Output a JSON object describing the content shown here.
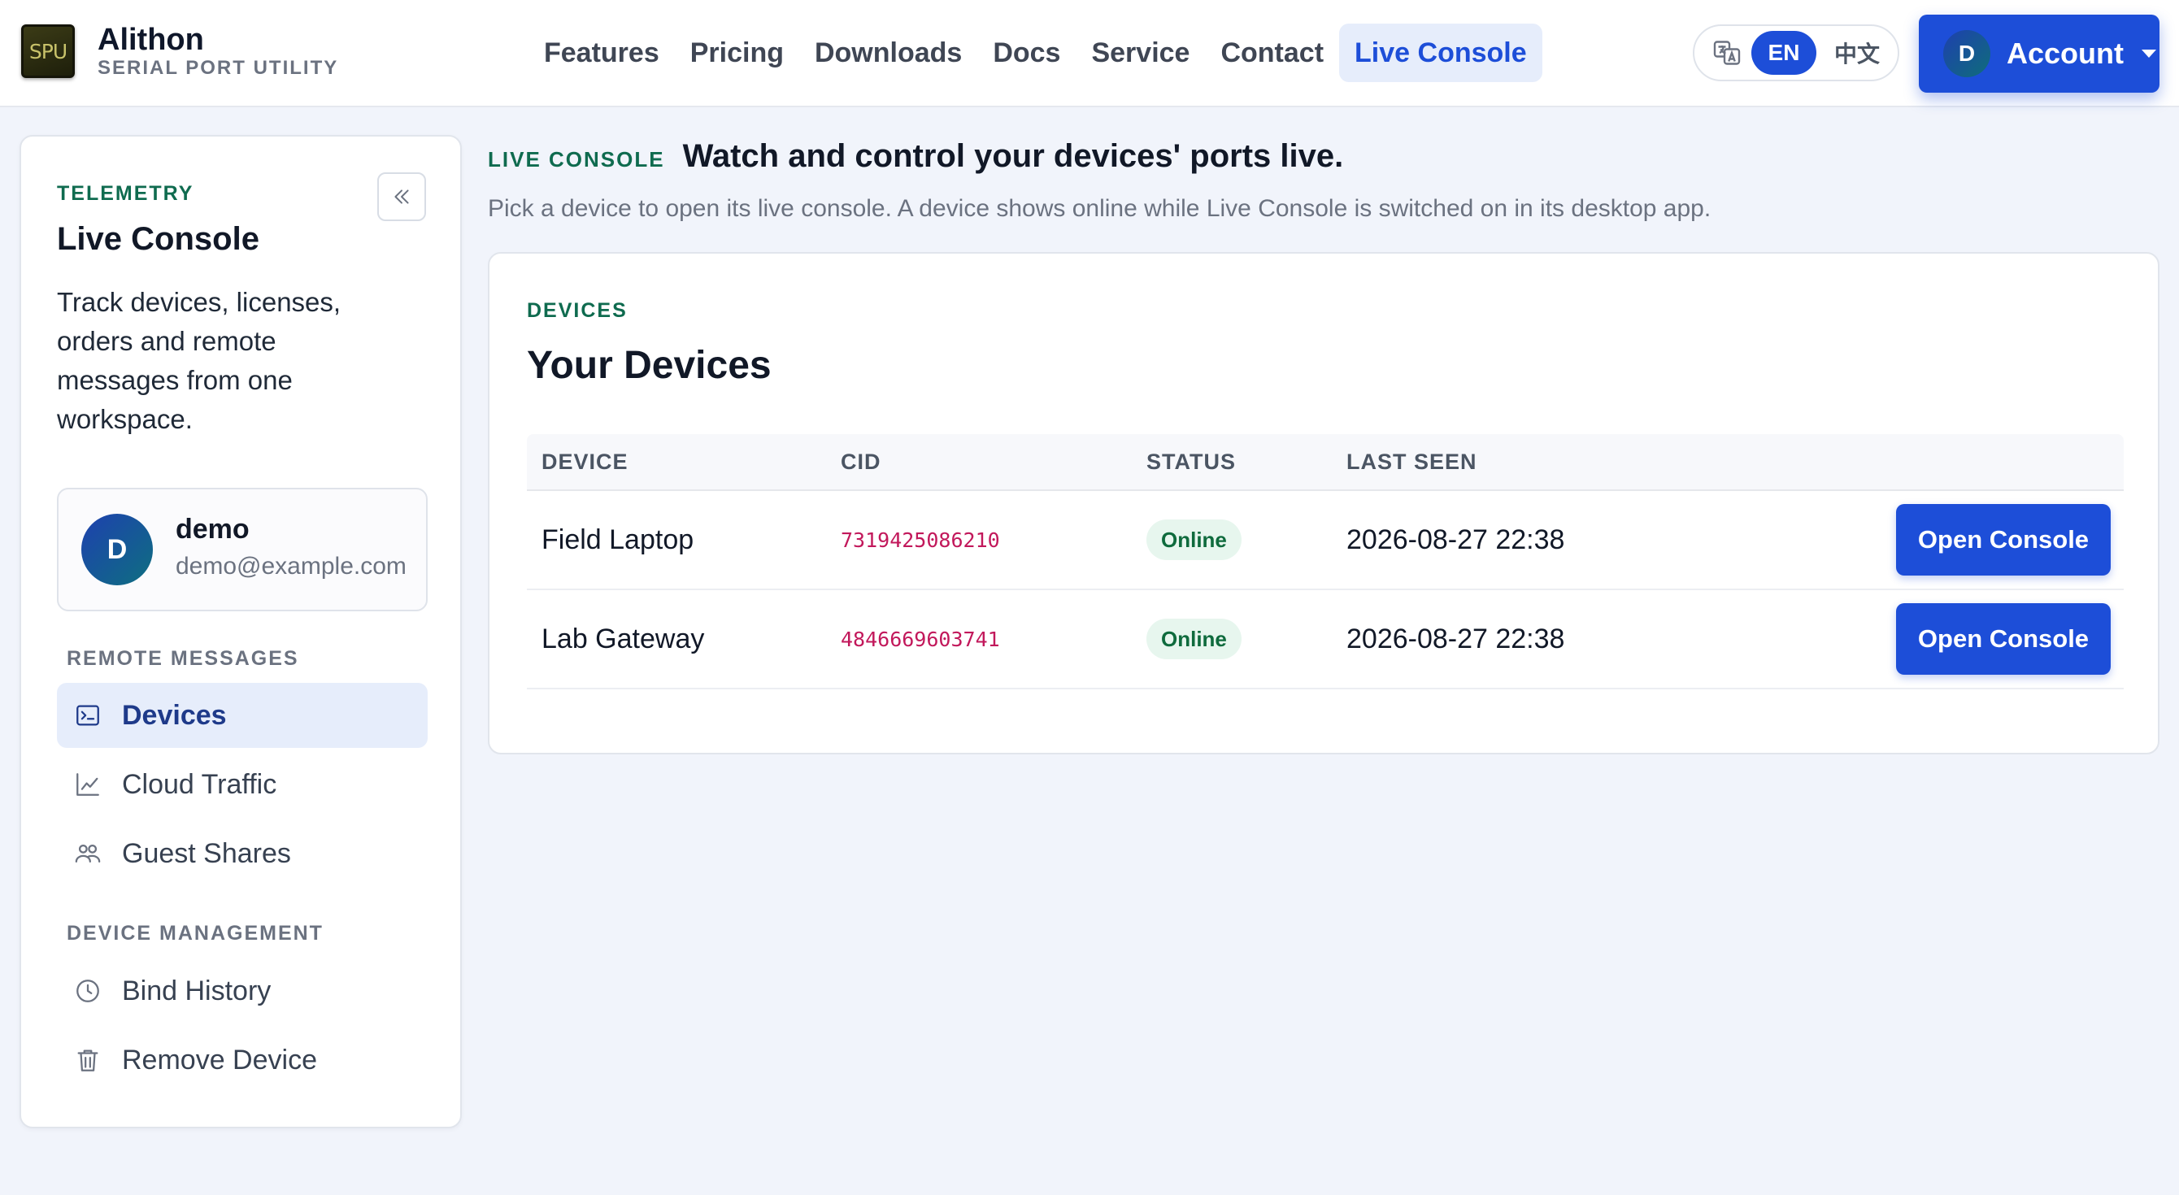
{
  "brand": {
    "logo_text": "SPU",
    "name": "Alithon",
    "subtitle": "SERIAL PORT UTILITY"
  },
  "nav": {
    "items": [
      {
        "label": "Features",
        "active": false
      },
      {
        "label": "Pricing",
        "active": false
      },
      {
        "label": "Downloads",
        "active": false
      },
      {
        "label": "Docs",
        "active": false
      },
      {
        "label": "Service",
        "active": false
      },
      {
        "label": "Contact",
        "active": false
      },
      {
        "label": "Live Console",
        "active": true
      }
    ]
  },
  "language": {
    "icon": "translate-icon",
    "selected": "EN",
    "alternate": "中文"
  },
  "account": {
    "avatar_initial": "D",
    "label": "Account"
  },
  "sidebar": {
    "eyebrow": "TELEMETRY",
    "title": "Live Console",
    "description": "Track devices, licenses, orders and remote messages from one workspace.",
    "user": {
      "initial": "D",
      "name": "demo",
      "email": "demo@example.com"
    },
    "sections": [
      {
        "label": "REMOTE MESSAGES",
        "items": [
          {
            "label": "Devices",
            "icon": "terminal-icon",
            "active": true
          },
          {
            "label": "Cloud Traffic",
            "icon": "line-chart-icon",
            "active": false
          },
          {
            "label": "Guest Shares",
            "icon": "users-icon",
            "active": false
          }
        ]
      },
      {
        "label": "DEVICE MANAGEMENT",
        "items": [
          {
            "label": "Bind History",
            "icon": "history-icon",
            "active": false
          },
          {
            "label": "Remove Device",
            "icon": "trash-icon",
            "active": false
          }
        ]
      }
    ]
  },
  "main": {
    "eyebrow": "LIVE CONSOLE",
    "title": "Watch and control your devices' ports live.",
    "description": "Pick a device to open its live console. A device shows online while Live Console is switched on in its desktop app.",
    "card": {
      "eyebrow": "DEVICES",
      "title": "Your Devices",
      "columns": [
        "DEVICE",
        "CID",
        "STATUS",
        "LAST SEEN"
      ],
      "rows": [
        {
          "device": "Field Laptop",
          "cid": "7319425086210",
          "status": "Online",
          "last_seen": "2026-08-27 22:38",
          "action": "Open Console"
        },
        {
          "device": "Lab Gateway",
          "cid": "4846669603741",
          "status": "Online",
          "last_seen": "2026-08-27 22:38",
          "action": "Open Console"
        }
      ]
    }
  },
  "colors": {
    "accent": "#1d4ed8",
    "eyebrow": "#0f6b4f",
    "cid": "#c2185b",
    "status_online_bg": "#e7f6ee",
    "status_online_text": "#0f6b3d"
  }
}
